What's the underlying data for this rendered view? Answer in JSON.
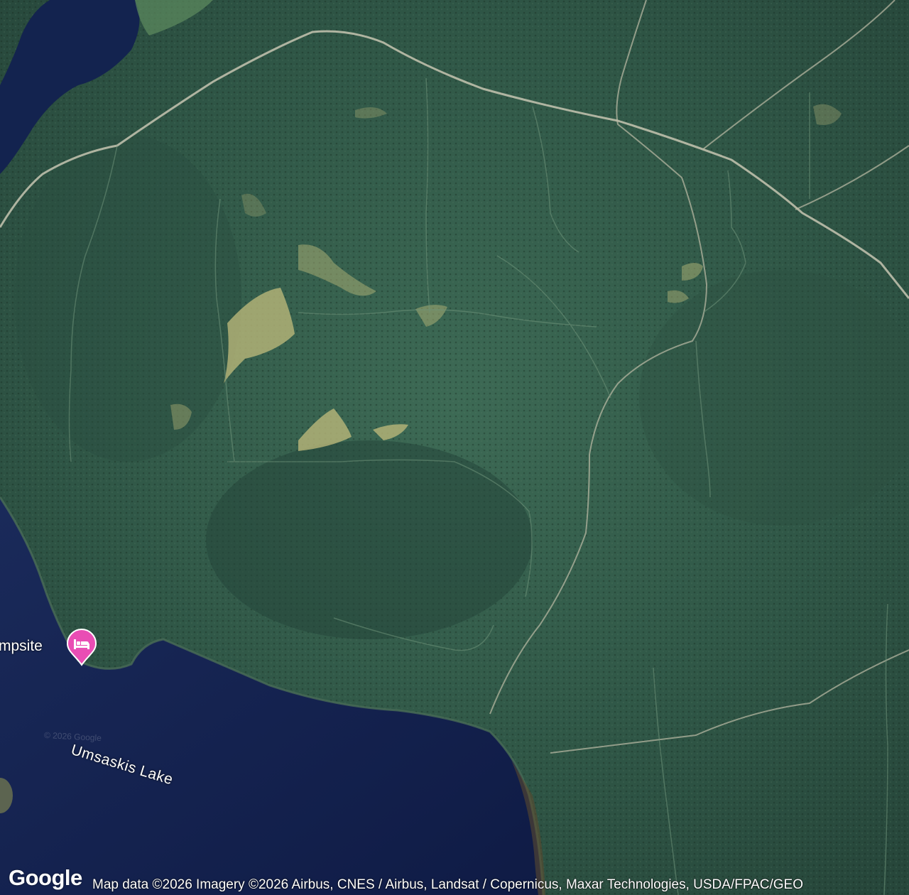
{
  "map": {
    "type": "satellite",
    "lake_label": "Umsaskis Lake",
    "faint_copyright": "© 2026 Google"
  },
  "poi": {
    "label": "mpsite",
    "icon": "hotel-bed-icon",
    "pin_color": "#e94db4"
  },
  "footer": {
    "logo": "Google",
    "attribution": "Map data ©2026 Imagery ©2026 Airbus, CNES / Airbus, Landsat / Copernicus, Maxar Technologies, USDA/FPAC/GEO"
  }
}
